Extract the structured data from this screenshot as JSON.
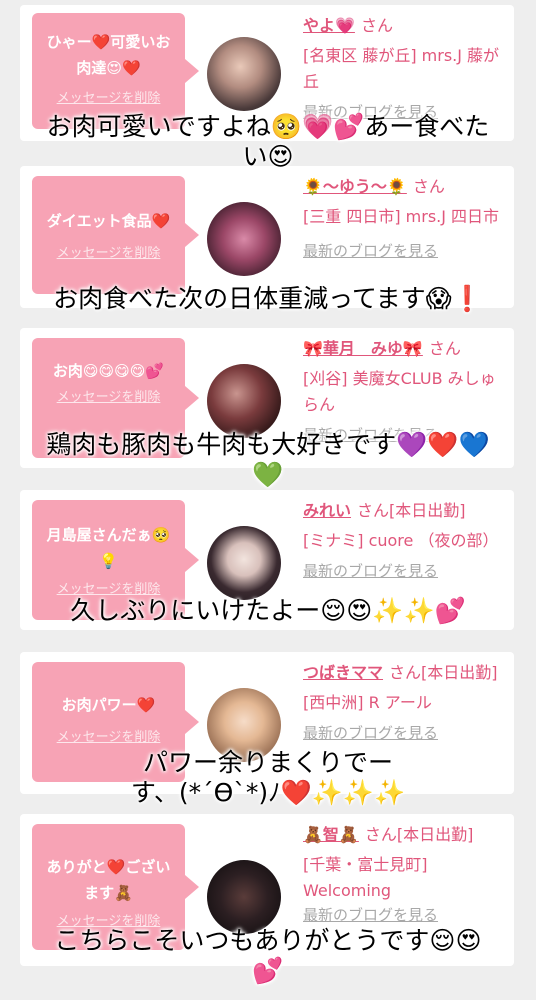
{
  "colors": {
    "bubble": "#f7a3b5",
    "name": "#e0567b",
    "blog_link": "#a8a8a8"
  },
  "cards": [
    {
      "message": "ひゃー❤️可愛いお肉達😍❤️",
      "delete_label": "メッセージを削除",
      "name": "やよ💗",
      "suffix": "さん",
      "shop": "[名東区 藤が丘] mrs.J 藤が丘",
      "blog_label": "最新のブログを見る",
      "caption_line1": "お肉可愛いですよね🥺💗💕あー食べた",
      "caption_line2": "い😍"
    },
    {
      "message": "ダイエット食品❤️",
      "delete_label": "メッセージを削除",
      "name": "🌻〜ゆう〜🌻",
      "suffix": "さん",
      "shop": "[三重 四日市] mrs.J 四日市",
      "blog_label": "最新のブログを見る",
      "caption_line1": "お肉食べた次の日体重減ってます😱❗️",
      "caption_line2": ""
    },
    {
      "message": "お肉😋😋😋😋💕",
      "delete_label": "メッセージを削除",
      "name": "🎀華月　みゆ🎀",
      "suffix": "さん",
      "shop": "[刈谷] 美魔女CLUB みしゅらん",
      "blog_label": "最新のブログを見る",
      "caption_line1": "鶏肉も豚肉も牛肉も大好きです💜❤️💙",
      "caption_line2": "💚"
    },
    {
      "message": "月島屋さんだぁ🥺💡",
      "delete_label": "メッセージを削除",
      "name": "みれい",
      "suffix": "さん[本日出勤]",
      "shop": "[ミナミ] cuore （夜の部）",
      "blog_label": "最新のブログを見る",
      "caption_line1": "久しぶりにいけたよー😌😍✨✨💕",
      "caption_line2": ""
    },
    {
      "message": "お肉パワー❤️",
      "delete_label": "メッセージを削除",
      "name": "つばきママ",
      "suffix": "さん[本日出勤]",
      "shop": "[西中洲] R アール",
      "blog_label": "最新のブログを見る",
      "caption_line1": "パワー余りまくりでー",
      "caption_line2": "す、(*´ϴ`*)ﾉ❤️✨✨✨"
    },
    {
      "message": "ありがと❤️ございます🧸",
      "delete_label": "メッセージを削除",
      "name": "🧸智🧸",
      "suffix": "さん[本日出勤]",
      "shop": "[千葉・富士見町] Welcoming",
      "blog_label": "最新のブログを見る",
      "caption_line1": "こちらこそいつもありがとうです😌😍",
      "caption_line2": "💕"
    }
  ]
}
